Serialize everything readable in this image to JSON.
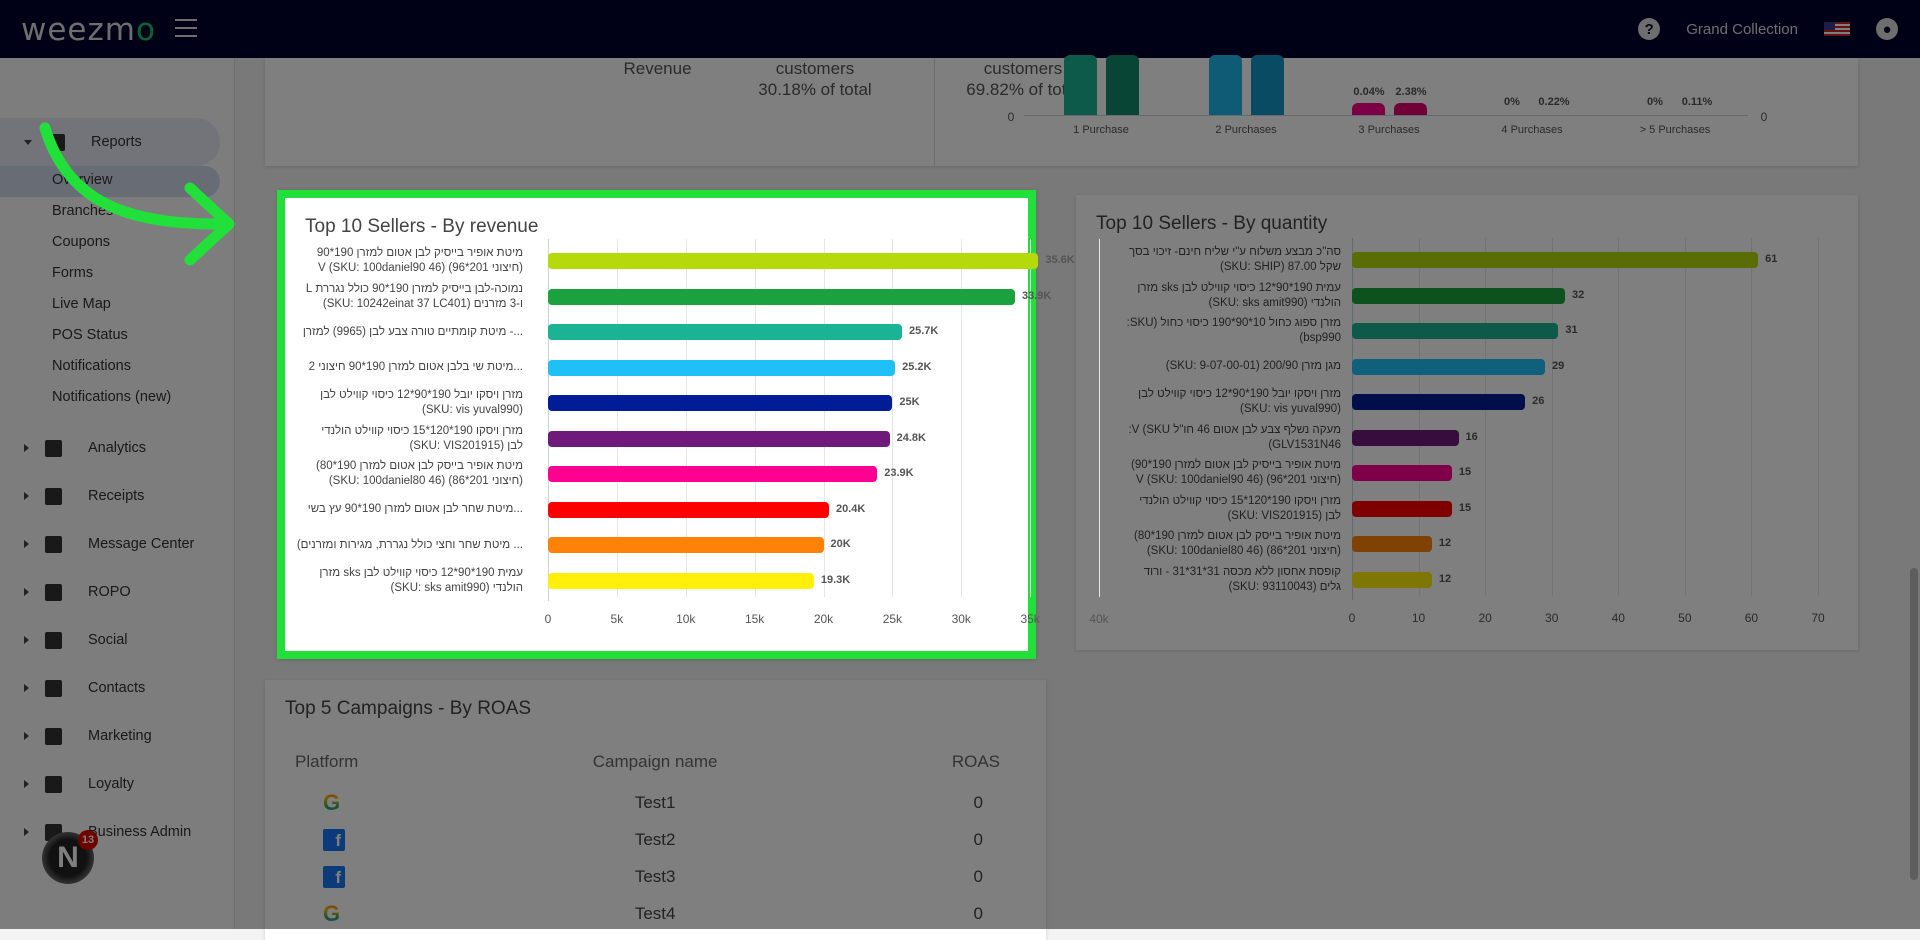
{
  "header": {
    "brand": "weezmo",
    "business": "Grand Collection",
    "icons": [
      "menu-icon",
      "help-icon",
      "us-flag-icon",
      "account-icon"
    ]
  },
  "sidebar": {
    "reports": "Reports",
    "sub": [
      "Overview",
      "Branches",
      "Coupons",
      "Forms",
      "Live Map",
      "POS Status",
      "Notifications",
      "Notifications (new)"
    ],
    "items": [
      "Analytics",
      "Receipts",
      "Message Center",
      "ROPO",
      "Social",
      "Contacts",
      "Marketing",
      "Loyalty",
      "Business Admin"
    ],
    "notification_count": "13"
  },
  "summary": {
    "col1": "Revenue",
    "col2": "customers",
    "col2_pct": "30.18% of total",
    "col3": "customers",
    "col3_pct": "69.82% of total",
    "purchase_chart": {
      "zero_left": "0",
      "zero_right": "0",
      "groups": [
        {
          "label": "1 Purchase",
          "labels": [
            "",
            ""
          ],
          "colors": [
            "#1ab394",
            "#128a6a"
          ]
        },
        {
          "label": "2 Purchases",
          "labels": [
            "",
            ""
          ],
          "colors": [
            "#1eb4e8",
            "#1496c8"
          ]
        },
        {
          "label": "3 Purchases",
          "labels": [
            "0.04%",
            "2.38%"
          ],
          "colors": [
            "#fc0088",
            "#e0006a"
          ]
        },
        {
          "label": "4 Purchases",
          "labels": [
            "0%",
            "0.22%"
          ],
          "colors": []
        },
        {
          "label": "> 5 Purchases",
          "labels": [
            "0%",
            "0.11%"
          ],
          "colors": []
        }
      ]
    }
  },
  "colors": [
    "#b5d90a",
    "#1ba23e",
    "#1ab394",
    "#1ec0f5",
    "#001c96",
    "#6f1a7a",
    "#ff0090",
    "#ff0000",
    "#ff8208",
    "#ffef0a"
  ],
  "chart_data": [
    {
      "type": "bar",
      "orientation": "horizontal",
      "title": "Top 10 Sellers - By revenue",
      "xlim": [
        0,
        40000
      ],
      "xticks": [
        "0",
        "5k",
        "10k",
        "15k",
        "20k",
        "25k",
        "30k",
        "35k",
        "40k"
      ],
      "grid": true,
      "categories": [
        [
          "מיטת אופיר בייסיק לבן אטום למזרן 190*90",
          "(חיצוני 201*96) V (SKU: 100daniel90 46)"
        ],
        [
          "נמוכה-לבן בייסיק למזרן 190*90 כולל נגררת L",
          "ו-3 מזרנים (SKU: 10242einat 37 LC401)"
        ],
        [
          "...- מיטת קומתיים טורה צבע לבן (9965) למזרן"
        ],
        [
          "...מיטת שי בלבן אטום למזרן 190*90 חיצוני 2"
        ],
        [
          "מזרן ויסקו יובל 190*90*12 כיסוי קווילט לבן",
          "(SKU: vis yuval990)"
        ],
        [
          "מזרן ויסקו 190*120*15 כיסוי קווילט הולנדי",
          "לבן (SKU: VIS201915)"
        ],
        [
          "מיטת אופיר בייסק לבן אטום למזרן 190*80)",
          "(חיצוני 201*86) (SKU: 100daniel80 46)"
        ],
        [
          "...מיטת שחר לבן אטום למזרן 190*90 עץ בשי"
        ],
        [
          "... מיטת שחר וחצי כולל נגררת, מגירות ומזרנים)"
        ],
        [
          "עמית 190*90*12 כיסוי קווילט לבן sks מזרן",
          "הולנדי (SKU: sks amit990)"
        ]
      ],
      "values": [
        35600,
        33900,
        25700,
        25200,
        25000,
        24800,
        23900,
        20400,
        20000,
        19300
      ],
      "data_labels": [
        "35.6K",
        "33.9K",
        "25.7K",
        "25.2K",
        "25K",
        "24.8K",
        "23.9K",
        "20.4K",
        "20K",
        "19.3K"
      ]
    },
    {
      "type": "bar",
      "orientation": "horizontal",
      "title": "Top 10 Sellers - By quantity",
      "xlim": [
        0,
        70
      ],
      "xticks": [
        "0",
        "10",
        "20",
        "30",
        "40",
        "50",
        "60",
        "70"
      ],
      "grid": true,
      "categories": [
        [
          "סה\"כ מבצע משלוח ע\"י שליח חינם- זיכוי בסך",
          "שקל 87.00 (SKU: SHIP)"
        ],
        [
          "עמית 190*90*12 כיסוי קווילט לבן sks מזרן",
          "הולנדי (SKU: sks amit990)"
        ],
        [
          "מזרן ספוג כחול 10*90*190 כיסוי כחול (SKU:",
          "bsp990)"
        ],
        [
          "מגן מזרן 200/90 (SKU: 9-07-00-01)"
        ],
        [
          "מזרן ויסקו יובל 190*90*12 כיסוי קווילט לבן",
          "(SKU: vis yuval990)"
        ],
        [
          "מעקה נשלף צבע לבן אטום 46 חו\"ל V (SKU:",
          "GLV1531N46)"
        ],
        [
          "מיטת אופיר בייסיק לבן אטום למזרן 190*90)",
          "(חיצוני 201*96) V (SKU: 100daniel90 46)"
        ],
        [
          "מזרן ויסקו 190*120*15 כיסוי קווילט הולנדי",
          "לבן (SKU: VIS201915)"
        ],
        [
          "מיטת אופיר בייסק לבן אטום למזרן 190*80)",
          "(חיצוני 201*86) (SKU: 100daniel80 46)"
        ],
        [
          "קופסת אחסון ללא מכסה 31*31*31 - ורוד",
          "גלים (SKU: 93110043)"
        ]
      ],
      "values": [
        61,
        32,
        31,
        29,
        26,
        16,
        15,
        15,
        12,
        12
      ],
      "data_labels": [
        "61",
        "32",
        "31",
        "29",
        "26",
        "16",
        "15",
        "15",
        "12",
        "12"
      ]
    }
  ],
  "campaigns": {
    "title": "Top 5 Campaigns - By ROAS",
    "headers": [
      "Platform",
      "Campaign name",
      "ROAS"
    ],
    "rows": [
      {
        "platform": "google",
        "name": "Test1",
        "roas": "0"
      },
      {
        "platform": "facebook",
        "name": "Test2",
        "roas": "0"
      },
      {
        "platform": "facebook",
        "name": "Test3",
        "roas": "0"
      },
      {
        "platform": "google",
        "name": "Test4",
        "roas": "0"
      }
    ]
  }
}
